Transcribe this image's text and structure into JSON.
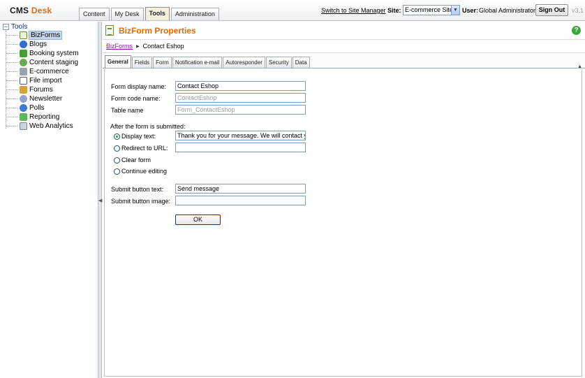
{
  "header": {
    "logo_cms": "CMS",
    "logo_desk": "Desk",
    "tabs": [
      "Content",
      "My Desk",
      "Tools",
      "Administration"
    ],
    "active_tab": "Tools",
    "switch_link": "Switch to Site Manager",
    "site_label": "Site:",
    "site_value": "E-commerce Site",
    "user_label": "User:",
    "user_name": "Global Administrator",
    "sign_out": "Sign Out",
    "version": "v3.1"
  },
  "sidebar": {
    "root": "Tools",
    "items": [
      {
        "label": "BizForms",
        "icon": "bizforms-icon",
        "selected": true
      },
      {
        "label": "Blogs",
        "icon": "blogs-icon"
      },
      {
        "label": "Booking system",
        "icon": "booking-icon"
      },
      {
        "label": "Content staging",
        "icon": "staging-icon"
      },
      {
        "label": "E-commerce",
        "icon": "ecommerce-icon"
      },
      {
        "label": "File import",
        "icon": "file-import-icon"
      },
      {
        "label": "Forums",
        "icon": "forums-icon"
      },
      {
        "label": "Newsletter",
        "icon": "newsletter-icon"
      },
      {
        "label": "Polls",
        "icon": "polls-icon"
      },
      {
        "label": "Reporting",
        "icon": "reporting-icon"
      },
      {
        "label": "Web Analytics",
        "icon": "analytics-icon"
      }
    ]
  },
  "main": {
    "title": "BizForm Properties",
    "breadcrumb": {
      "link": "BizForms",
      "current": "Contact Eshop"
    },
    "tabs": [
      "General",
      "Fields",
      "Form",
      "Notification e-mail",
      "Autoresponder",
      "Security",
      "Data"
    ],
    "active_tab": "General",
    "form": {
      "display_name_label": "Form display name:",
      "display_name_value": "Contact Eshop",
      "code_name_label": "Form code name:",
      "code_name_value": "ContactEshop",
      "table_name_label": "Table name",
      "table_name_value": "Form_ContactEshop",
      "after_submit_label": "After the form is submitted:",
      "display_text_label": "Display text:",
      "display_text_value": "Thank you for your message. We will contact you",
      "redirect_label": "Redirect to URL:",
      "redirect_value": "",
      "clear_form_label": "Clear form",
      "continue_editing_label": "Continue editing",
      "submit_text_label": "Submit button text:",
      "submit_text_value": "Send message",
      "submit_image_label": "Submit button image:",
      "submit_image_value": "",
      "ok_label": "OK"
    }
  },
  "colors": {
    "accent_orange": "#e26b0a",
    "link_purple": "#7a1d8b",
    "tree_blue": "#003399"
  }
}
